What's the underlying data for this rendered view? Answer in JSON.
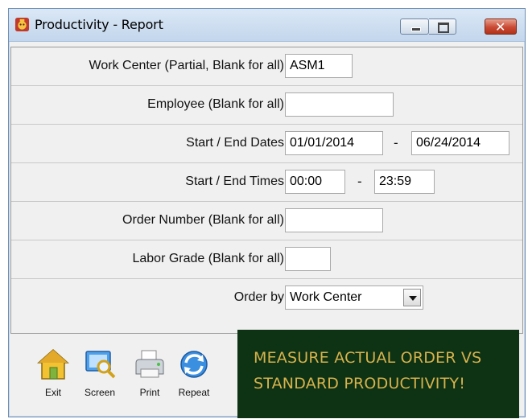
{
  "window": {
    "title": "Productivity - Report",
    "icon": "report-app-icon",
    "controls": {
      "minimize": "minimize-icon",
      "maximize": "maximize-icon",
      "close": "close-icon"
    }
  },
  "form": {
    "work_center": {
      "label": "Work Center (Partial, Blank for all)",
      "value": "ASM1"
    },
    "employee": {
      "label": "Employee (Blank for all)",
      "value": ""
    },
    "dates": {
      "label": "Start / End Dates",
      "start": "01/01/2014",
      "separator": "-",
      "end": "06/24/2014"
    },
    "times": {
      "label": "Start / End Times",
      "start": "00:00",
      "separator": "-",
      "end": "23:59"
    },
    "order_number": {
      "label": "Order Number (Blank for all)",
      "value": ""
    },
    "labor_grade": {
      "label": "Labor Grade (Blank for all)",
      "value": ""
    },
    "order_by": {
      "label": "Order by",
      "selected": "Work Center"
    }
  },
  "toolbar": {
    "exit": {
      "label": "Exit",
      "icon": "house-icon"
    },
    "screen": {
      "label": "Screen",
      "icon": "screen-magnifier-icon"
    },
    "print": {
      "label": "Print",
      "icon": "printer-icon"
    },
    "repeat": {
      "label": "Repeat",
      "icon": "repeat-arrows-icon"
    }
  },
  "banner": {
    "line1": "MEASURE ACTUAL ORDER VS",
    "line2": "STANDARD PRODUCTIVITY!",
    "background": "#0e3214",
    "text_color": "#d6b24c"
  }
}
